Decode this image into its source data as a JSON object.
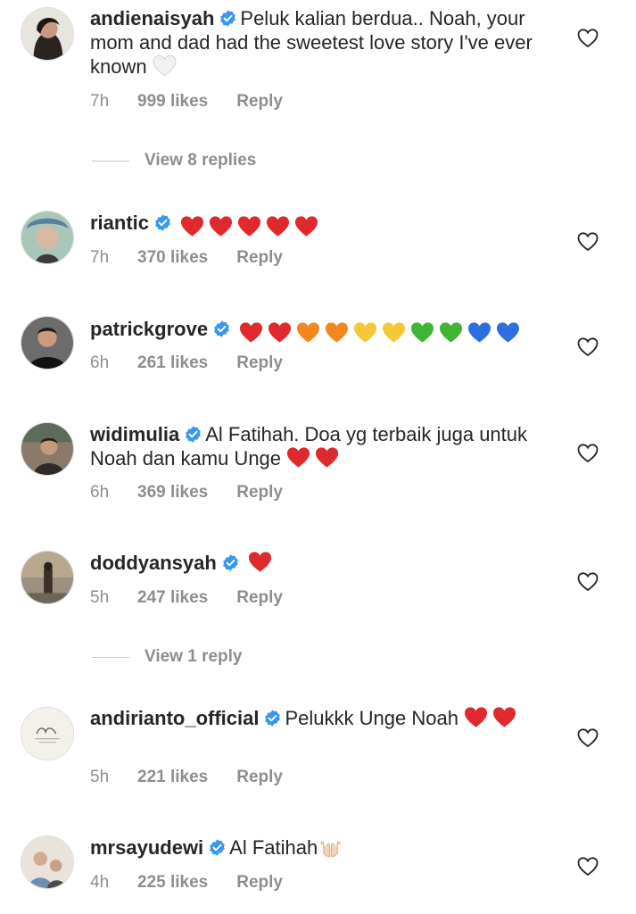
{
  "colors": {
    "text": "#262626",
    "meta": "#8e8e8e",
    "verified": "#3897f0"
  },
  "comments": [
    {
      "username": "andienaisyah",
      "text": "Peluk kalian berdua.. Noah, your mom and dad had the sweetest love story I've ever known",
      "emojis": [
        "white-heart"
      ],
      "time": "7h",
      "likes": "999 likes",
      "reply": "Reply",
      "view_replies": "View 8 replies"
    },
    {
      "username": "riantic",
      "text": "",
      "emojis": [
        "red-heart",
        "red-heart",
        "red-heart",
        "red-heart",
        "red-heart"
      ],
      "time": "7h",
      "likes": "370 likes",
      "reply": "Reply"
    },
    {
      "username": "patrickgrove",
      "text": "",
      "emojis": [
        "red-heart",
        "red-heart",
        "orange-heart",
        "orange-heart",
        "yellow-heart",
        "yellow-heart",
        "green-heart",
        "green-heart",
        "blue-heart",
        "blue-heart"
      ],
      "time": "6h",
      "likes": "261 likes",
      "reply": "Reply"
    },
    {
      "username": "widimulia",
      "text": "Al Fatihah. Doa yg terbaik juga untuk Noah dan kamu Unge",
      "emojis": [
        "red-heart",
        "red-heart"
      ],
      "time": "6h",
      "likes": "369 likes",
      "reply": "Reply"
    },
    {
      "username": "doddyansyah",
      "text": "",
      "emojis": [
        "red-heart"
      ],
      "time": "5h",
      "likes": "247 likes",
      "reply": "Reply",
      "view_replies": "View 1 reply"
    },
    {
      "username": "andirianto_official",
      "text": "Pelukkk Unge Noah",
      "emojis": [
        "red-heart",
        "red-heart"
      ],
      "time": "5h",
      "likes": "221 likes",
      "reply": "Reply"
    },
    {
      "username": "mrsayudewi",
      "text": "Al Fatihah",
      "emojis": [
        "palms-up-together"
      ],
      "time": "4h",
      "likes": "225 likes",
      "reply": "Reply"
    }
  ]
}
